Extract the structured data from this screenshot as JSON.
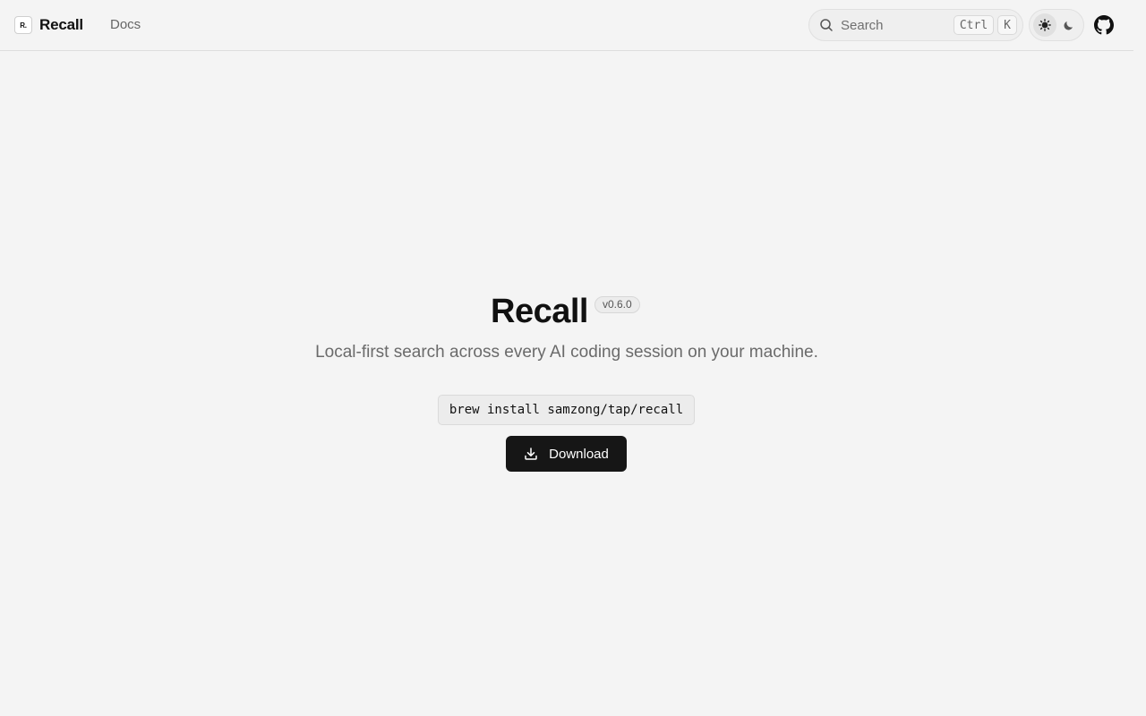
{
  "header": {
    "logo_mark": "R.",
    "app_name": "Recall",
    "nav_docs": "Docs",
    "search": {
      "placeholder": "Search",
      "shortcut_ctrl": "Ctrl",
      "shortcut_key": "K"
    },
    "theme": {
      "selected": "light",
      "options": [
        "light",
        "dark"
      ]
    },
    "github_icon": "github-icon"
  },
  "hero": {
    "title": "Recall",
    "version": "v0.6.0",
    "tagline": "Local-first search across every AI coding session on your machine.",
    "install_command": "brew install samzong/tap/recall",
    "download_label": "Download"
  },
  "colors": {
    "background": "#f4f4f4",
    "primary_button": "#161616",
    "text_muted": "#6a6a6a"
  }
}
